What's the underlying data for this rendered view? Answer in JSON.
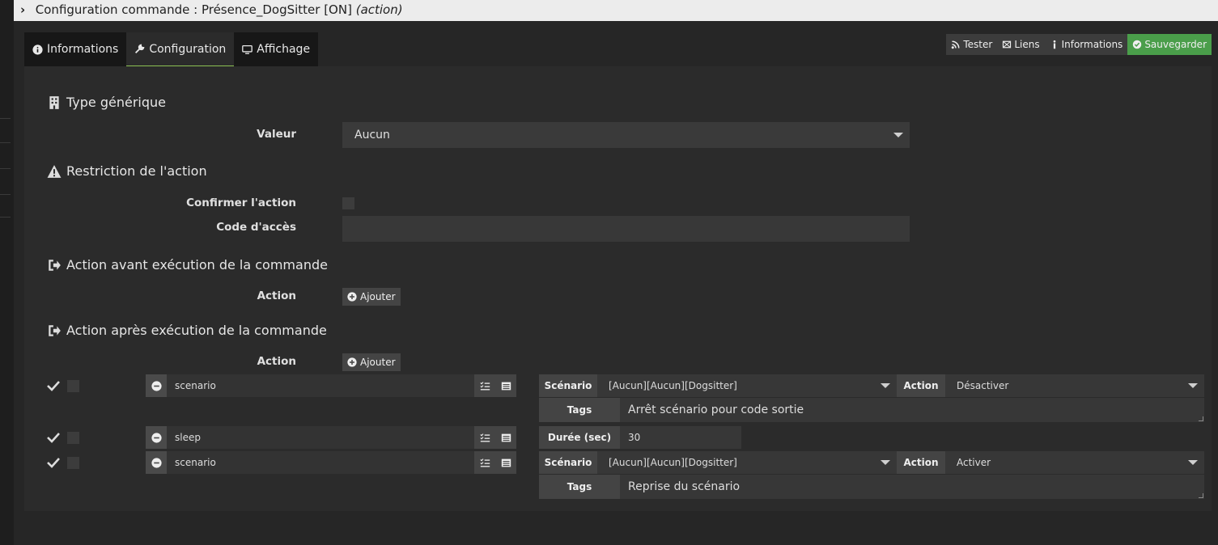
{
  "window": {
    "title_prefix": "Configuration commande : Présence_DogSitter [ON]",
    "title_suffix": "(action)"
  },
  "tabs": [
    {
      "label": "Informations",
      "icon": "info-circle-icon"
    },
    {
      "label": "Configuration",
      "icon": "wrench-icon"
    },
    {
      "label": "Affichage",
      "icon": "monitor-icon"
    }
  ],
  "toolbar": {
    "tester_label": "Tester",
    "liens_label": "Liens",
    "informations_label": "Informations",
    "save_label": "Sauvegarder",
    "save_color": "#4a9e4a"
  },
  "generic_type": {
    "title": "Type générique",
    "valeur_label": "Valeur",
    "valeur_value": "Aucun"
  },
  "restriction": {
    "title": "Restriction de l'action",
    "confirm_label": "Confirmer l'action",
    "code_label": "Code d'accès",
    "code_value": ""
  },
  "before": {
    "title": "Action avant exécution de la commande",
    "action_label": "Action",
    "add_label": "Ajouter"
  },
  "after": {
    "title": "Action après exécution de la commande",
    "action_label": "Action",
    "add_label": "Ajouter",
    "rows": [
      {
        "cmd": "scenario",
        "scenario_label": "Scénario",
        "scenario_value": "[Aucun][Aucun][Dogsitter]",
        "action_label": "Action",
        "action_value": "Désactiver",
        "tags_label": "Tags",
        "tags_value": "Arrêt scénario pour code sortie"
      },
      {
        "cmd": "sleep",
        "duree_label": "Durée (sec)",
        "duree_value": "30"
      },
      {
        "cmd": "scenario",
        "scenario_label": "Scénario",
        "scenario_value": "[Aucun][Aucun][Dogsitter]",
        "action_label": "Action",
        "action_value": "Activer",
        "tags_label": "Tags",
        "tags_value": "Reprise du scénario"
      }
    ]
  }
}
